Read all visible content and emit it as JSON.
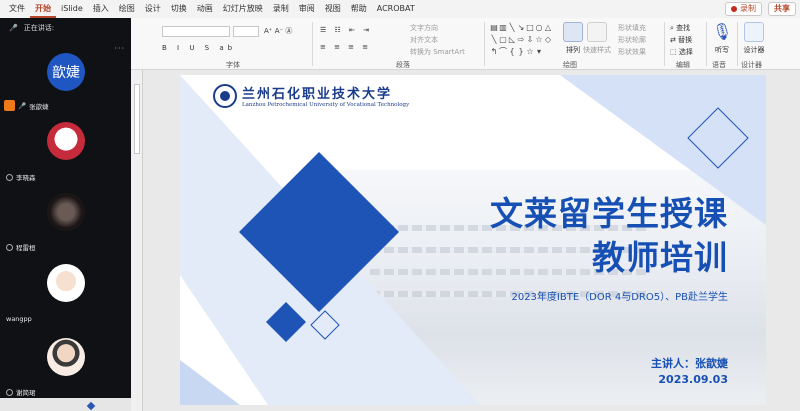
{
  "ribbon": {
    "tabs": [
      "文件",
      "开始",
      "iSlide",
      "插入",
      "绘图",
      "设计",
      "切换",
      "动画",
      "幻灯片放映",
      "录制",
      "审阅",
      "视图",
      "帮助",
      "ACROBAT"
    ],
    "active_tab": "开始",
    "record_label": "录制",
    "share_label": "共享",
    "groups": {
      "font": "字体",
      "paragraph": "段落",
      "drawing": "绘图",
      "editing": "编辑",
      "voice": "语音",
      "designer": "设计器"
    },
    "paragraph_items": {
      "text_direction": "文字方向",
      "align_text": "对齐文本",
      "smartart": "转换为 SmartArt"
    },
    "drawing_items": {
      "arrange": "排列",
      "quick_styles": "快速样式",
      "shape_fill": "形状填充",
      "shape_outline": "形状轮廓",
      "shape_effects": "形状效果"
    },
    "editing_items": {
      "find": "查找",
      "replace": "替换",
      "select": "选择"
    },
    "voice_items": {
      "dictate": "听写"
    },
    "designer_items": {
      "design_ideas": "设计器"
    }
  },
  "meeting": {
    "speaking_label": "正在讲话:",
    "host_avatar_text": "歆婕",
    "participants": [
      {
        "name": "张歆婕"
      },
      {
        "name": "李晓森"
      },
      {
        "name": "程雷桓"
      },
      {
        "name": "wangpp"
      },
      {
        "name": "谢简珺"
      }
    ]
  },
  "slide": {
    "university_cn": "兰州石化职业技术大学",
    "university_en": "Lanzhou Petrochemical University of Vocational Technology",
    "title_line1": "文莱留学生授课",
    "title_line2": "教师培训",
    "subtitle": "2023年度IBTE（DOR 4与DRO5）、PB赴兰学生",
    "presenter": "主讲人：张歆婕",
    "date": "2023.09.03"
  },
  "colors": {
    "accent": "#b7472a",
    "slide_blue": "#1750b5",
    "diamond_blue": "#1e54b6",
    "panel_bg": "#0f1115"
  }
}
